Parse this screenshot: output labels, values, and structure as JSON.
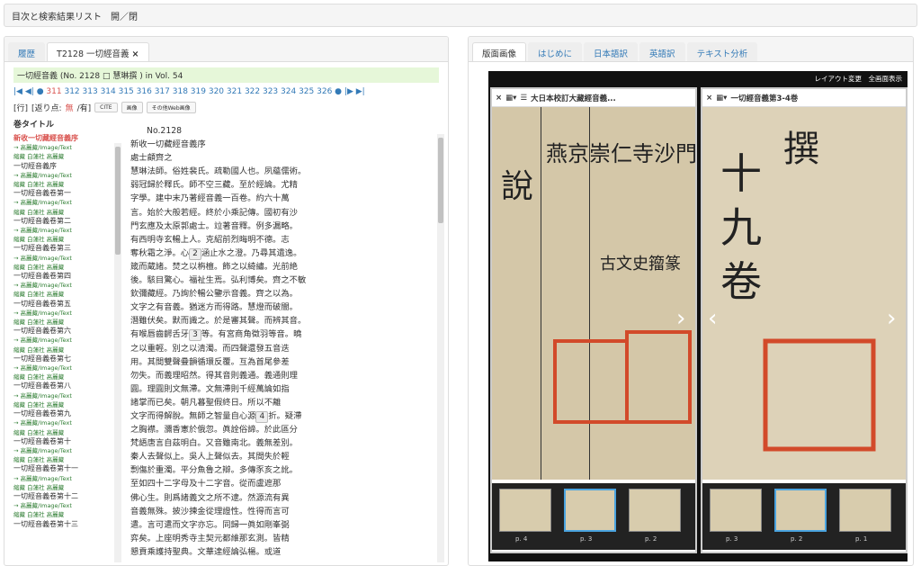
{
  "topbar": {
    "label": "目次と検索結果リスト　開／閉"
  },
  "left": {
    "tabs": [
      "履歴",
      "T2128 一切經音義",
      "×"
    ],
    "title": "一切經音義 (No. 2128",
    "title_author": "慧琳撰 ) in Vol. 54",
    "pager": {
      "pages": [
        "311",
        "312",
        "313",
        "314",
        "315",
        "316",
        "317",
        "318",
        "319",
        "320",
        "321",
        "322",
        "323",
        "324",
        "325",
        "326"
      ],
      "current": "311"
    },
    "tools": {
      "a": "[行]",
      "b": "[返り点:",
      "c": "無",
      "d": "/有]",
      "btn1": "CITE",
      "btn2": "画像",
      "btn3": "その他Web画像"
    },
    "toc_label": "巻タイトル",
    "toc_main": "新收一切藏經音義序",
    "toc_sub": "→ 高麗藏/Image/Text",
    "toc_links": "縮藏 白蓮社 高麗藏",
    "toc_items": [
      "一切經音義序",
      "一切經音義卷第一",
      "一切經音義卷第二",
      "一切經音義卷第三",
      "一切經音義卷第四",
      "一切經音義卷第五",
      "一切經音義卷第六",
      "一切經音義卷第七",
      "一切經音義卷第八",
      "一切經音義卷第九",
      "一切經音義卷第十",
      "一切經音義卷第十一",
      "一切經音義卷第十二",
      "一切經音義卷第十三"
    ],
    "text_no": "No.2128",
    "lines": [
      "新收一切藏經音義序",
      "處士顧齊之",
      "慧琳法師。俗姓裴氏。疏勒國人也。夙蘊儒術。",
      "弱冠歸於釋氏。師不空三藏。至於經論。尤精",
      "字學。建中末乃著經音義一百卷。約六十萬",
      "言。始於大般若經。終於小乘記傳。國初有沙",
      "門玄應及太原郭處士。竝著音釋。例多漏略。",
      "有西明寺玄暢上人。克紹前烈晦明不德。志",
      "奪秋霜之淨。心",
      "涵止水之澄。乃尋其遺逸。",
      "箴而蔵諸。焚之以栴檀。飾之以綺繡。光前絶",
      "後。駭目驚心。福祉生焉。弘利博矣。齊之不敏",
      "欽彌藏經。乃詢於暢公鑒示音義。齊之以為。",
      "文字之有音義。猶迷方而得路。慧燈而破闇。",
      "潛雖伏矣。默而識之。於是審其聲。而辨其音。",
      "有喉唇齒齶舌牙",
      "等。有宮商角徵羽等音。曉",
      "之以重輕。別之以清濁。而四聲還發五音迭",
      "用。其間雙聲疊韻循環反覆。互為首尾參差",
      "勿失。而義理昭然。得其音則義通。義通則理",
      "圓。理圓則文無滯。文無滯則千經萬論如指",
      "諸掌而已矣。朝凡暮聖假終日。所以不離",
      "文字而得解脫。無師之智量自心源",
      "折。疑滯",
      "之胸襟。瀰香憲於俄忽。眞詮俗諦。於此區分",
      "梵語唐言自茲明白。又音雖南北。義無差別。",
      "秦人去聲似上。吳人上聲似去。其間失於輕",
      "剽傷於重濁。平分魚魯之辯。多傳豕亥之訛。",
      "至如四十二字母及十二字音。從而盧遮那",
      "佛心生。則爲諸義文之所不逮。然源流有異",
      "音義無殊。披沙揀金從理證性。性得而言可",
      "遣。言可遣而文字亦忘。同歸一眞如剛峯弼",
      "弈矣。上座明秀寺主契元都維那玄測。皆精",
      "懇貢乘護持聖典。文華達經論弘楊。或道"
    ],
    "line_nums": [
      "1",
      "2",
      "3",
      "4"
    ]
  },
  "right": {
    "tabs": [
      "版面画像",
      "はじめに",
      "日本語訳",
      "英語訳",
      "テキスト分析"
    ],
    "viewer_top": "レイアウト変更　全画面表示",
    "pane1_title": "大日本校訂大藏經音義...",
    "pane2_title": "一切經音義第3-4巻",
    "thumbs1": [
      "p. 4",
      "p. 3",
      "p. 2"
    ],
    "thumbs2": [
      "p. 3",
      "p. 2",
      "p. 1"
    ]
  }
}
